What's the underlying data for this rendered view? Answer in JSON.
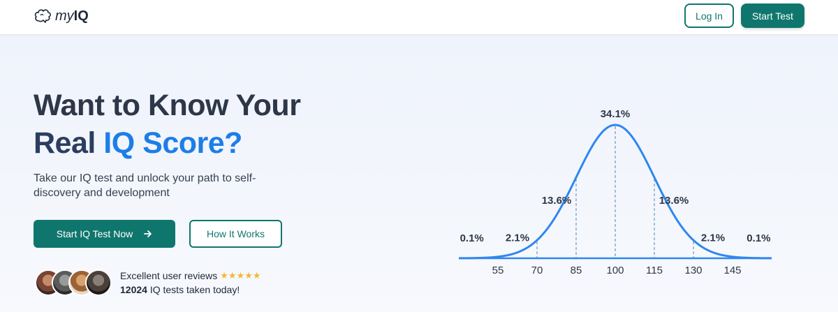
{
  "header": {
    "logo_text_my": "my",
    "logo_text_iq": "IQ",
    "login_label": "Log In",
    "start_test_label": "Start Test"
  },
  "hero": {
    "title_line1": "Want to Know Your",
    "title_line2_part1": "Real",
    "title_line2_part2": "IQ Score?",
    "subtitle": "Take our IQ test and unlock your path to self-discovery and development",
    "cta_label": "Start IQ Test Now",
    "how_label": "How It Works"
  },
  "social": {
    "reviews_text": "Excellent user reviews",
    "stars": "★★★★★",
    "rating": 5,
    "tests_count": "12024",
    "tests_text": "IQ tests taken today!"
  },
  "colors": {
    "primary": "#0f766e",
    "accent_blue": "#1d7ee6",
    "curve": "#2f86f0",
    "star": "#f5b730"
  },
  "chart_data": {
    "type": "line",
    "x_ticks": [
      "55",
      "70",
      "85",
      "100",
      "115",
      "130",
      "145"
    ],
    "x_tick_values": [
      55,
      70,
      85,
      100,
      115,
      130,
      145
    ],
    "mean": 100,
    "sd": 15,
    "xlim": [
      40,
      160
    ],
    "percent_labels": [
      {
        "x": 45,
        "text": "0.1%"
      },
      {
        "x": 62.5,
        "text": "2.1%"
      },
      {
        "x": 77.5,
        "text": "13.6%"
      },
      {
        "x": 100,
        "text": "34.1%"
      },
      {
        "x": 122.5,
        "text": "13.6%"
      },
      {
        "x": 137.5,
        "text": "2.1%"
      },
      {
        "x": 155,
        "text": "0.1%"
      }
    ],
    "dashed_lines_x": [
      70,
      85,
      100,
      115,
      130
    ],
    "grid": false
  }
}
